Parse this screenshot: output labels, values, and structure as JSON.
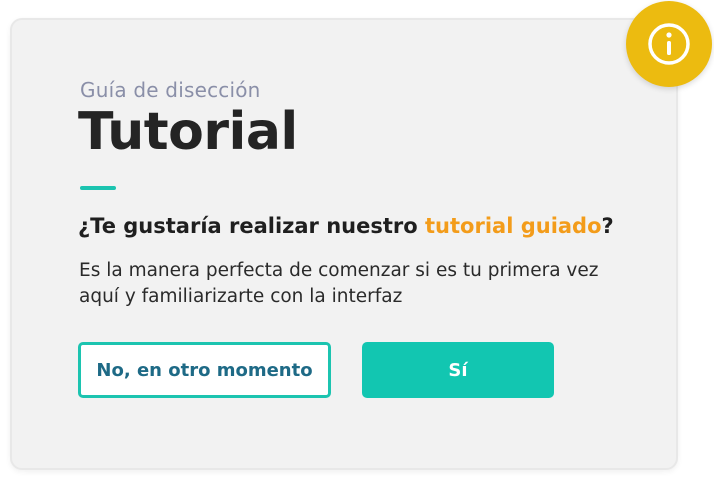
{
  "dialog": {
    "eyebrow": "Guía de disección",
    "title": "Tutorial",
    "question_prefix": "¿Te gustaría realizar nuestro ",
    "question_highlight": "tutorial guiado",
    "question_suffix": "?",
    "description": "Es la manera perfecta de comenzar si es tu primera vez aquí y familiarizarte con la interfaz",
    "decline_label": "No, en otro momento",
    "accept_label": "Sí"
  },
  "icons": {
    "badge": "info-icon"
  },
  "colors": {
    "accent_teal": "#1cc4b0",
    "primary_button": "#12c6b1",
    "highlight_orange": "#f39c1a",
    "badge_yellow": "#ecbb10",
    "decline_text": "#1e6a86",
    "eyebrow_text": "#8a8fa8",
    "card_background": "#f2f2f2"
  }
}
